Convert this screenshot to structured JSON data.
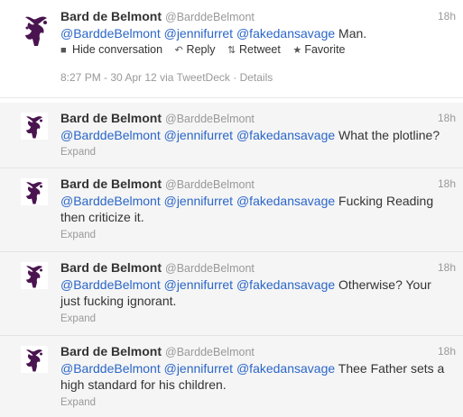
{
  "main_tweet": {
    "fullname": "Bard de Belmont",
    "username": "@BarddeBelmont",
    "time": "18h",
    "mentions": [
      "@BarddeBelmont",
      "@jennifurret",
      "@fakedansavage"
    ],
    "text": "Man.",
    "actions": {
      "hide": "Hide conversation",
      "reply": "Reply",
      "retweet": "Retweet",
      "favorite": "Favorite"
    },
    "timestamp": "8:27 PM - 30 Apr 12 via TweetDeck",
    "separator": "·",
    "details": "Details"
  },
  "replies": [
    {
      "fullname": "Bard de Belmont",
      "username": "@BarddeBelmont",
      "time": "18h",
      "mentions": [
        "@BarddeBelmont",
        "@jennifurret",
        "@fakedansavage"
      ],
      "text_line1": "What the plotline?",
      "text_line2": "",
      "expand": "Expand"
    },
    {
      "fullname": "Bard de Belmont",
      "username": "@BarddeBelmont",
      "time": "18h",
      "mentions": [
        "@BarddeBelmont",
        "@jennifurret",
        "@fakedansavage"
      ],
      "text_line1": "Fucking Reading",
      "text_line2": "then criticize it.",
      "expand": "Expand"
    },
    {
      "fullname": "Bard de Belmont",
      "username": "@BarddeBelmont",
      "time": "18h",
      "mentions": [
        "@BarddeBelmont",
        "@jennifurret",
        "@fakedansavage"
      ],
      "text_line1": "Otherwise? Your",
      "text_line2": "just fucking ignorant.",
      "expand": "Expand"
    },
    {
      "fullname": "Bard de Belmont",
      "username": "@BarddeBelmont",
      "time": "18h",
      "mentions": [
        "@BarddeBelmont",
        "@jennifurret",
        "@fakedansavage"
      ],
      "text_line1": "Thee Father sets a",
      "text_line2": "high standard for his children.",
      "expand": "Expand"
    }
  ],
  "icons": {
    "avatar": "purple-flourish-avatar-icon",
    "hide": "speech-bubble-icon",
    "reply": "reply-arrow-icon",
    "retweet": "retweet-arrows-icon",
    "favorite": "star-icon"
  },
  "colors": {
    "link": "#2a66c8",
    "muted": "#999999",
    "reply_bg": "#f5f5f5",
    "avatar_purple": "#4a1450"
  }
}
